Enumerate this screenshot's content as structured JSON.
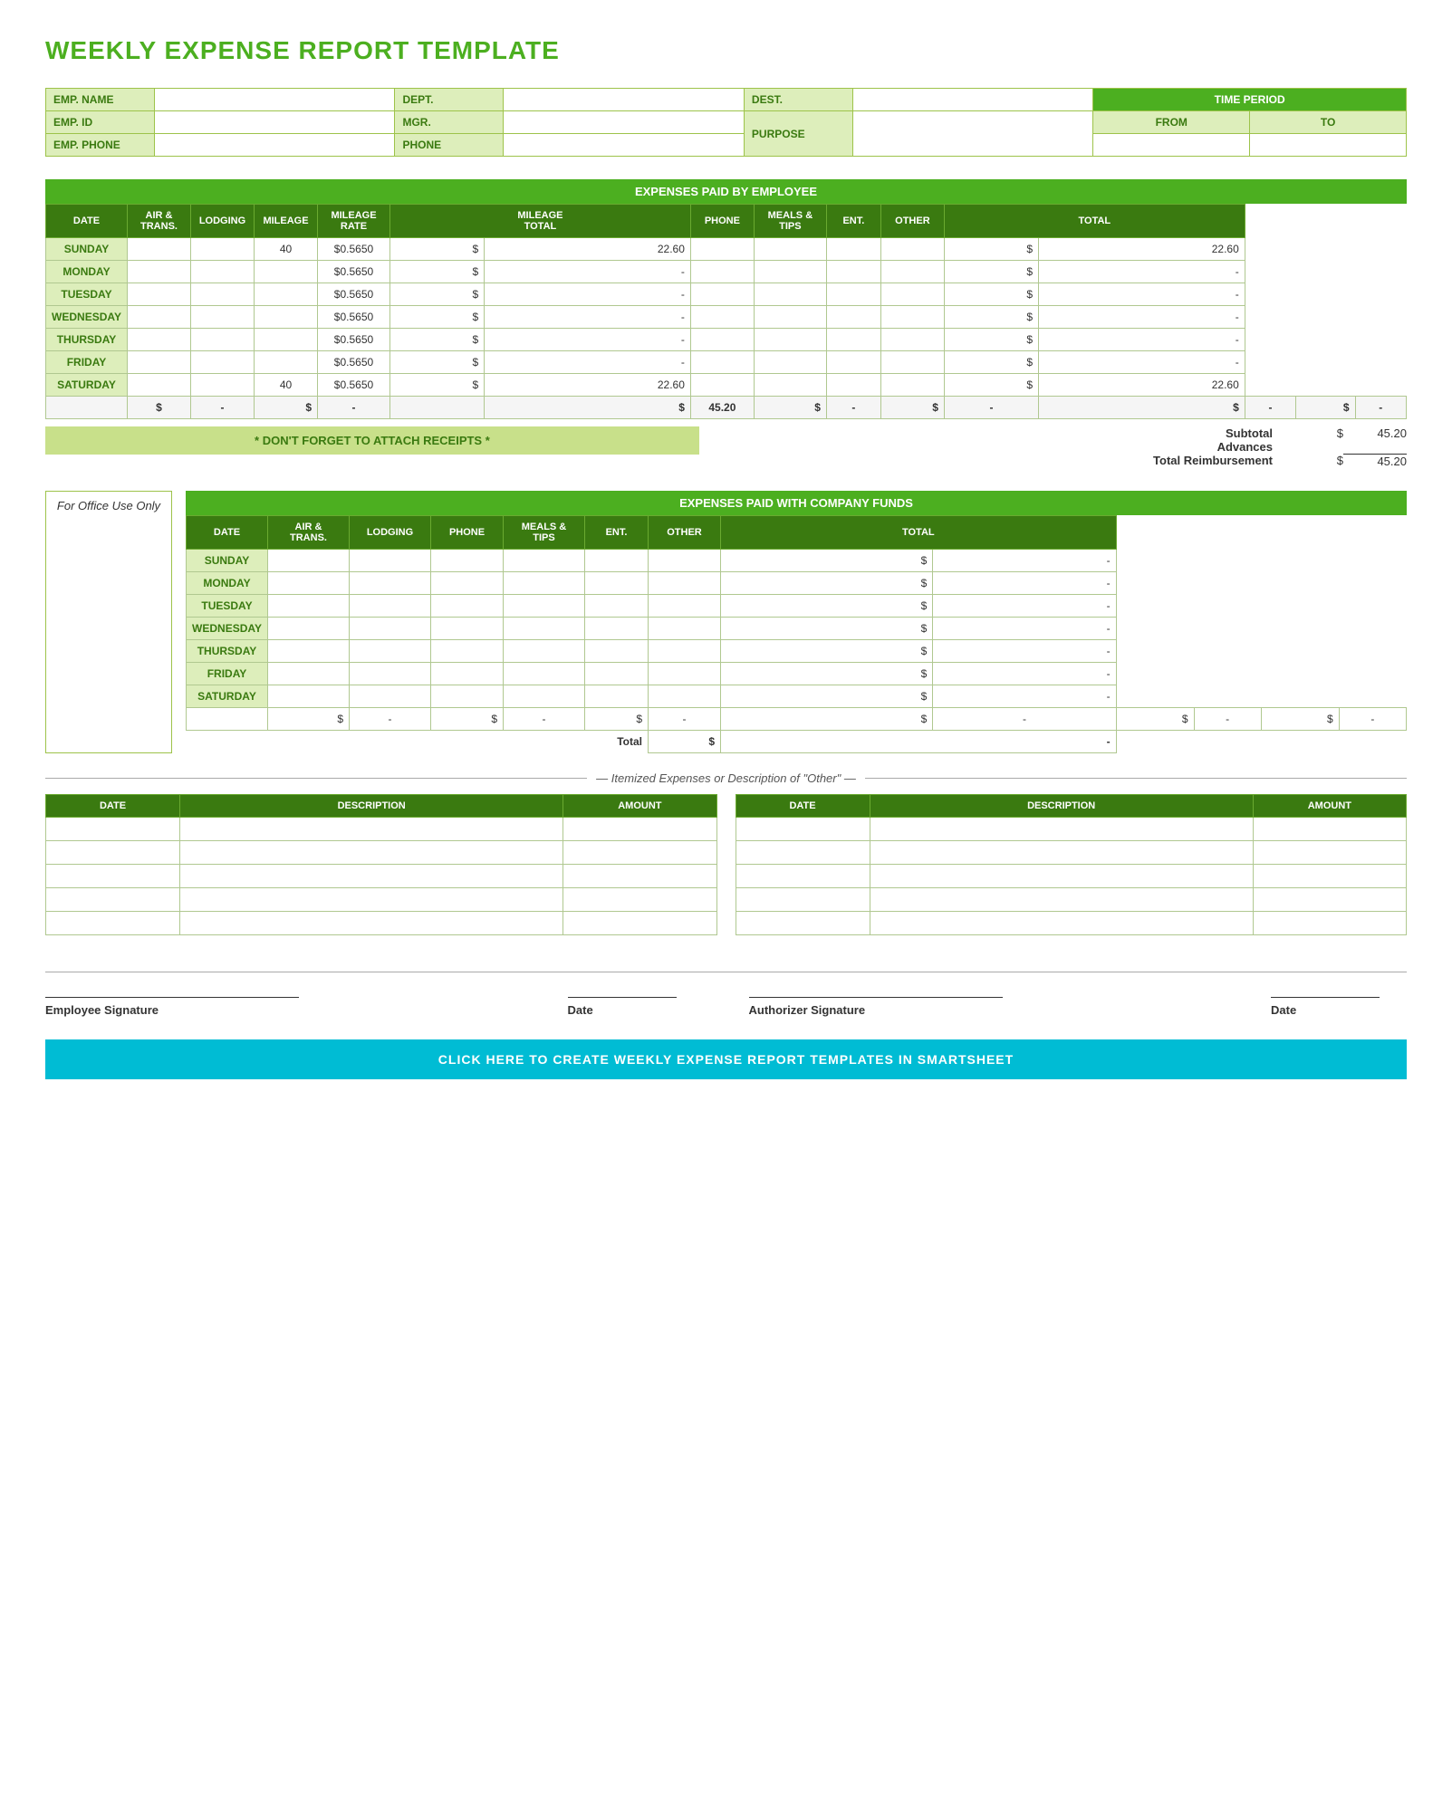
{
  "title": "WEEKLY EXPENSE REPORT TEMPLATE",
  "emp_info": {
    "emp_name_label": "EMP. NAME",
    "dept_label": "DEPT.",
    "dest_label": "DEST.",
    "time_period_label": "TIME PERIOD",
    "emp_id_label": "EMP. ID",
    "mgr_label": "MGR.",
    "purpose_label": "PURPOSE",
    "from_label": "FROM",
    "to_label": "TO",
    "emp_phone_label": "EMP. PHONE",
    "phone_label": "PHONE"
  },
  "expenses_paid_section": {
    "header": "EXPENSES PAID BY EMPLOYEE",
    "columns": [
      "DATE",
      "AIR & TRANS.",
      "LODGING",
      "MILEAGE",
      "MILEAGE RATE",
      "MILEAGE TOTAL",
      "PHONE",
      "MEALS & TIPS",
      "ENT.",
      "OTHER",
      "TOTAL"
    ],
    "rows": [
      {
        "day": "SUNDAY",
        "air_trans": "",
        "lodging": "",
        "mileage": "40",
        "mileage_rate": "$0.5650",
        "mileage_total_sign": "$",
        "mileage_total": "22.60",
        "phone": "",
        "meals_tips": "",
        "ent": "",
        "other": "",
        "total_sign": "$",
        "total": "22.60"
      },
      {
        "day": "MONDAY",
        "air_trans": "",
        "lodging": "",
        "mileage": "",
        "mileage_rate": "$0.5650",
        "mileage_total_sign": "$",
        "mileage_total": "-",
        "phone": "",
        "meals_tips": "",
        "ent": "",
        "other": "",
        "total_sign": "$",
        "total": "-"
      },
      {
        "day": "TUESDAY",
        "air_trans": "",
        "lodging": "",
        "mileage": "",
        "mileage_rate": "$0.5650",
        "mileage_total_sign": "$",
        "mileage_total": "-",
        "phone": "",
        "meals_tips": "",
        "ent": "",
        "other": "",
        "total_sign": "$",
        "total": "-"
      },
      {
        "day": "WEDNESDAY",
        "air_trans": "",
        "lodging": "",
        "mileage": "",
        "mileage_rate": "$0.5650",
        "mileage_total_sign": "$",
        "mileage_total": "-",
        "phone": "",
        "meals_tips": "",
        "ent": "",
        "other": "",
        "total_sign": "$",
        "total": "-"
      },
      {
        "day": "THURSDAY",
        "air_trans": "",
        "lodging": "",
        "mileage": "",
        "mileage_rate": "$0.5650",
        "mileage_total_sign": "$",
        "mileage_total": "-",
        "phone": "",
        "meals_tips": "",
        "ent": "",
        "other": "",
        "total_sign": "$",
        "total": "-"
      },
      {
        "day": "FRIDAY",
        "air_trans": "",
        "lodging": "",
        "mileage": "",
        "mileage_rate": "$0.5650",
        "mileage_total_sign": "$",
        "mileage_total": "-",
        "phone": "",
        "meals_tips": "",
        "ent": "",
        "other": "",
        "total_sign": "$",
        "total": "-"
      },
      {
        "day": "SATURDAY",
        "air_trans": "",
        "lodging": "",
        "mileage": "40",
        "mileage_rate": "$0.5650",
        "mileage_total_sign": "$",
        "mileage_total": "22.60",
        "phone": "",
        "meals_tips": "",
        "ent": "",
        "other": "",
        "total_sign": "$",
        "total": "22.60"
      }
    ],
    "totals_row": {
      "air_sign": "$",
      "air": "-",
      "lodging_sign": "$",
      "lodging": "-",
      "mileage_total_sign": "$",
      "mileage_total": "45.20",
      "phone_sign": "$",
      "phone": "-",
      "meals_sign": "$",
      "meals": "-",
      "ent_sign": "$",
      "ent": "-",
      "other_sign": "$",
      "other": "-"
    },
    "subtotal_label": "Subtotal",
    "subtotal_sign": "$",
    "subtotal_value": "45.20",
    "advances_label": "Advances",
    "advances_sign": "",
    "advances_value": "",
    "total_reimb_label": "Total Reimbursement",
    "total_reimb_sign": "$",
    "total_reimb_value": "45.20"
  },
  "receipts_notice": "* DON'T FORGET TO ATTACH RECEIPTS *",
  "office_use_label": "For Office Use Only",
  "company_funds_section": {
    "header": "EXPENSES PAID WITH COMPANY FUNDS",
    "columns": [
      "DATE",
      "AIR & TRANS.",
      "LODGING",
      "PHONE",
      "MEALS & TIPS",
      "ENT.",
      "OTHER",
      "TOTAL"
    ],
    "rows": [
      {
        "day": "SUNDAY",
        "air_trans": "",
        "lodging": "",
        "phone": "",
        "meals_tips": "",
        "ent": "",
        "other": "",
        "total_sign": "$",
        "total": "-"
      },
      {
        "day": "MONDAY",
        "air_trans": "",
        "lodging": "",
        "phone": "",
        "meals_tips": "",
        "ent": "",
        "other": "",
        "total_sign": "$",
        "total": "-"
      },
      {
        "day": "TUESDAY",
        "air_trans": "",
        "lodging": "",
        "phone": "",
        "meals_tips": "",
        "ent": "",
        "other": "",
        "total_sign": "$",
        "total": "-"
      },
      {
        "day": "WEDNESDAY",
        "air_trans": "",
        "lodging": "",
        "phone": "",
        "meals_tips": "",
        "ent": "",
        "other": "",
        "total_sign": "$",
        "total": "-"
      },
      {
        "day": "THURSDAY",
        "air_trans": "",
        "lodging": "",
        "phone": "",
        "meals_tips": "",
        "ent": "",
        "other": "",
        "total_sign": "$",
        "total": "-"
      },
      {
        "day": "FRIDAY",
        "air_trans": "",
        "lodging": "",
        "phone": "",
        "meals_tips": "",
        "ent": "",
        "other": "",
        "total_sign": "$",
        "total": "-"
      },
      {
        "day": "SATURDAY",
        "air_trans": "",
        "lodging": "",
        "phone": "",
        "meals_tips": "",
        "ent": "",
        "other": "",
        "total_sign": "$",
        "total": "-"
      }
    ],
    "totals_row": {
      "air_sign": "$",
      "air": "-",
      "lodging_sign": "$",
      "lodging": "-",
      "phone_sign": "$",
      "phone": "-",
      "meals_sign": "$",
      "meals": "-",
      "ent_sign": "$",
      "ent": "-",
      "other_sign": "$",
      "other": "-"
    },
    "total_label": "Total",
    "total_sign": "$",
    "total_value": "-"
  },
  "itemized_section": {
    "header": "Itemized Expenses or Description of \"Other\"",
    "left_table": {
      "columns": [
        "DATE",
        "DESCRIPTION",
        "AMOUNT"
      ],
      "rows": [
        {
          "date": "",
          "description": "",
          "amount": ""
        },
        {
          "date": "",
          "description": "",
          "amount": ""
        },
        {
          "date": "",
          "description": "",
          "amount": ""
        },
        {
          "date": "",
          "description": "",
          "amount": ""
        },
        {
          "date": "",
          "description": "",
          "amount": ""
        }
      ]
    },
    "right_table": {
      "columns": [
        "DATE",
        "DESCRIPTION",
        "AMOUNT"
      ],
      "rows": [
        {
          "date": "",
          "description": "",
          "amount": ""
        },
        {
          "date": "",
          "description": "",
          "amount": ""
        },
        {
          "date": "",
          "description": "",
          "amount": ""
        },
        {
          "date": "",
          "description": "",
          "amount": ""
        },
        {
          "date": "",
          "description": "",
          "amount": ""
        }
      ]
    }
  },
  "signatures": {
    "employee_sig_label": "Employee Signature",
    "date_label_1": "Date",
    "authorizer_sig_label": "Authorizer Signature",
    "date_label_2": "Date"
  },
  "cta_banner": "CLICK HERE TO CREATE WEEKLY EXPENSE REPORT TEMPLATES IN SMARTSHEET",
  "colors": {
    "green_dark": "#3a7a10",
    "green_medium": "#4caf20",
    "green_light": "#ddeebb",
    "green_border": "#9dc34a",
    "cyan": "#00bcd4"
  }
}
